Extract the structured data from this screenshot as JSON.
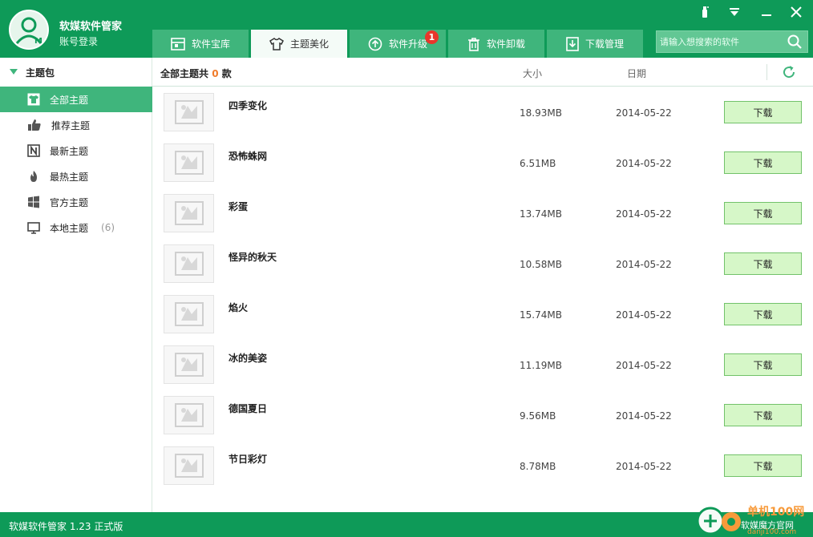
{
  "app": {
    "title": "软媒软件管家",
    "account_label": "账号登录"
  },
  "tabs": [
    {
      "label": "软件宝库",
      "icon": "store-icon"
    },
    {
      "label": "主题美化",
      "icon": "tshirt-icon",
      "active": true
    },
    {
      "label": "软件升级",
      "icon": "upgrade-icon",
      "badge": "1"
    },
    {
      "label": "软件卸载",
      "icon": "trash-icon"
    },
    {
      "label": "下载管理",
      "icon": "download-icon"
    }
  ],
  "search": {
    "placeholder": "请输入想搜索的软件"
  },
  "sidebar": {
    "header": "主题包",
    "items": [
      {
        "label": "全部主题",
        "icon": "tshirt-icon",
        "active": true
      },
      {
        "label": "推荐主题",
        "icon": "thumbs-up-icon"
      },
      {
        "label": "最新主题",
        "icon": "new-icon"
      },
      {
        "label": "最热主题",
        "icon": "fire-icon"
      },
      {
        "label": "官方主题",
        "icon": "windows-icon"
      },
      {
        "label": "本地主题",
        "icon": "monitor-icon",
        "count": "(6)"
      }
    ]
  },
  "list": {
    "title_prefix": "全部主题共",
    "count": "0",
    "title_suffix": "款",
    "col_size": "大小",
    "col_date": "日期",
    "download_label": "下载",
    "rows": [
      {
        "name": "四季变化",
        "size": "18.93MB",
        "date": "2014-05-22"
      },
      {
        "name": "恐怖蛛网",
        "size": "6.51MB",
        "date": "2014-05-22"
      },
      {
        "name": "彩蛋",
        "size": "13.74MB",
        "date": "2014-05-22"
      },
      {
        "name": "怪异的秋天",
        "size": "10.58MB",
        "date": "2014-05-22"
      },
      {
        "name": "焰火",
        "size": "15.74MB",
        "date": "2014-05-22"
      },
      {
        "name": "冰的美姿",
        "size": "11.19MB",
        "date": "2014-05-22"
      },
      {
        "name": "德国夏日",
        "size": "9.56MB",
        "date": "2014-05-22"
      },
      {
        "name": "节日彩灯",
        "size": "8.78MB",
        "date": "2014-05-22"
      }
    ]
  },
  "status": {
    "version": "软媒软件管家 1.23 正式版"
  },
  "watermark": {
    "top": "单机100网",
    "sub": "软媒魔方官网",
    "url": "danji100.com"
  },
  "colors": {
    "brand_green": "#0e9a58",
    "accent_green": "#3fb57c",
    "count_orange": "#f07b2a",
    "badge_red": "#e8362b"
  }
}
